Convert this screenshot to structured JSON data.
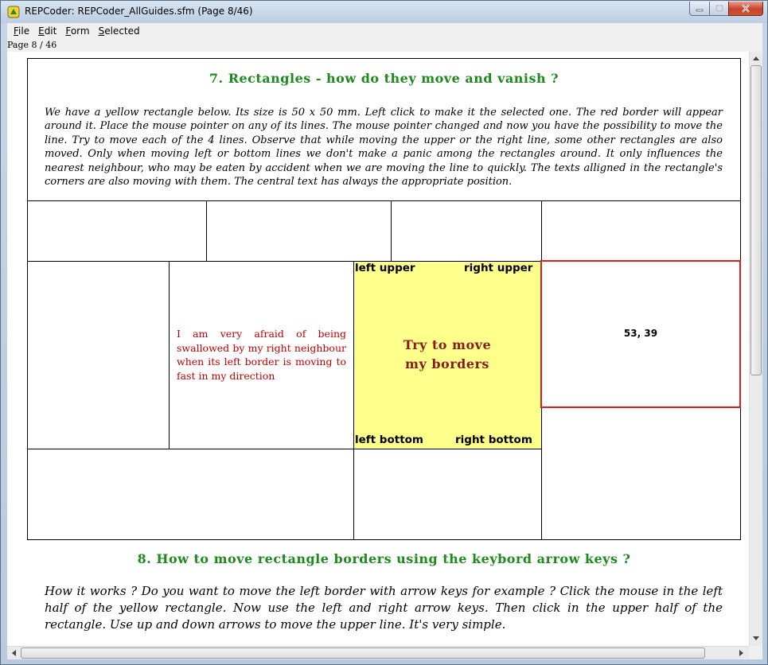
{
  "window": {
    "title": "REPCoder:  REPCoder_AllGuides.sfm  (Page 8/46)",
    "app_icon": "repcoder-app-icon"
  },
  "menu": {
    "items": [
      "File",
      "Edit",
      "Form",
      "Selected"
    ]
  },
  "page_label": "Page 8 / 46",
  "section7": {
    "heading": "7. Rectangles - how do they move and vanish ?",
    "paragraph": "We have a yellow rectangle below. Its size is 50 x 50 mm. Left click to make it the selected one. The red border will appear around it. Place the mouse pointer on any of its lines. The mouse pointer changed and now you have the possibility to move the line. Try to move each of the 4 lines. Observe that while moving the upper or the right line, some other rectangles are also moved. Only when moving left or bottom lines we don't make a panic among the rectangles around. It only influences the nearest neighbour, who may be eaten by accident when we are moving the line to quickly. The texts alligned in the rectangle's corners are also moving with them. The central text has always the appropriate position."
  },
  "demo": {
    "neighbour_text": "I am very afraid of being swallowed by my right neighbour when its left border is moving to fast in my direction",
    "yellow": {
      "left_upper": "left upper",
      "right_upper": "right upper",
      "left_bottom": "left bottom",
      "right_bottom": "right bottom",
      "center": "Try to move my borders"
    },
    "selected_coords": "53, 39"
  },
  "section8": {
    "heading": "8. How to move rectangle borders using the keybord arrow keys ?",
    "paragraph": "How it works ? Do you want to move the left border with arrow keys for example ? Click the mouse in the left half of the yellow rectangle. Now use the left and right arrow keys. Then click in the upper half of the rectangle. Use up and down arrows to move the upper line. It's very simple."
  },
  "colors": {
    "heading_green": "#1c8a1c",
    "neighbour_red": "#c00000",
    "center_text": "#8b1a1a",
    "yellow_fill": "#ffff8c",
    "selection_border": "#d42020"
  }
}
